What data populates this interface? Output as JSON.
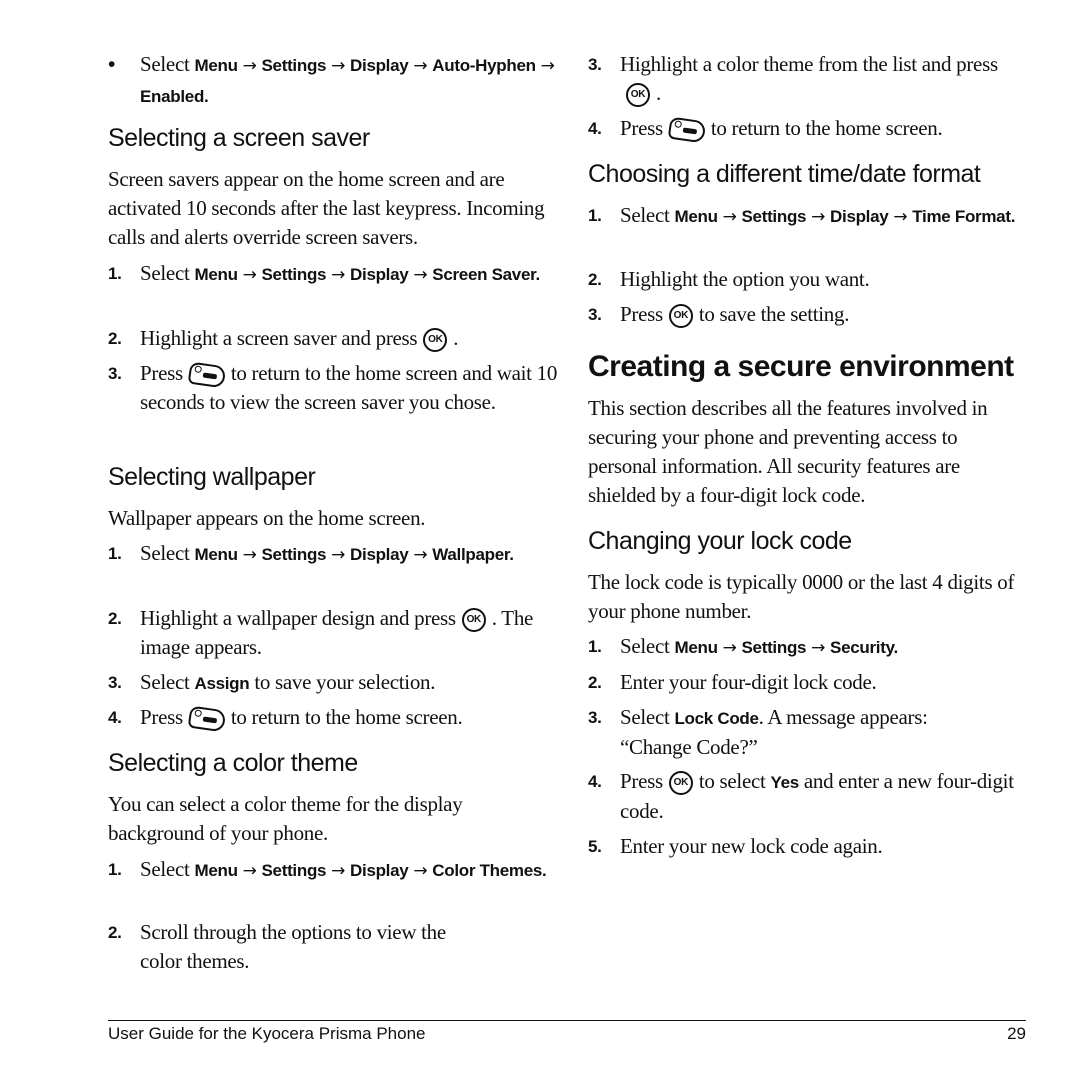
{
  "left": {
    "intro_bullet": {
      "select": "Select",
      "menu": "Menu",
      "settings": "Settings",
      "display": "Display",
      "autohyphen": "Auto-Hyphen",
      "enabled": "Enabled",
      "arrow": "→",
      "bullet": "•"
    },
    "screen_saver": {
      "heading": "Selecting a screen saver",
      "para": "Screen savers appear on the home screen and are activated 10 seconds after the last keypress. Incoming calls and alerts override screen savers.",
      "steps": [
        {
          "num": "1.",
          "select": "Select",
          "menu": "Menu",
          "settings": "Settings",
          "display": "Display",
          "target": "Screen Saver."
        },
        {
          "num": "2.",
          "pre": "Highlight a screen saver and press",
          "post": "."
        },
        {
          "num": "3.",
          "pre": "Press",
          "post": "to return to the home screen and wait 10 seconds to view the screen saver you chose."
        }
      ]
    },
    "wallpaper": {
      "heading": "Selecting wallpaper",
      "para": "Wallpaper appears on the home screen.",
      "steps": [
        {
          "num": "1.",
          "select": "Select",
          "menu": "Menu",
          "settings": "Settings",
          "display": "Display",
          "target": "Wallpaper"
        },
        {
          "num": "2.",
          "pre": "Highlight a wallpaper design and press",
          "post": ". The image appears."
        },
        {
          "num": "3.",
          "pre": "Select",
          "bold": "Assign",
          "post": "to save your selection."
        },
        {
          "num": "4.",
          "pre": "Press",
          "post": "to return to the home screen."
        }
      ]
    },
    "color_theme": {
      "heading": "Selecting a color theme",
      "para": "You can select a color theme for the display background of your phone.",
      "steps": [
        {
          "num": "1.",
          "select": "Select",
          "menu": "Menu",
          "settings": "Settings",
          "display": "Display",
          "target": "Color Themes"
        },
        {
          "num": "2.",
          "text": "Scroll through the options to view the color themes."
        }
      ]
    }
  },
  "right": {
    "color_theme_cont": [
      {
        "num": "3.",
        "pre": "Highlight a color theme from the list and press",
        "post": "."
      },
      {
        "num": "4.",
        "pre": "Press",
        "post": "to return to the home screen."
      }
    ],
    "time_date": {
      "heading": "Choosing a different time/date format",
      "steps": [
        {
          "num": "1.",
          "select": "Select",
          "menu": "Menu",
          "settings": "Settings",
          "display": "Display",
          "target": "Time Format"
        },
        {
          "num": "2.",
          "text": "Highlight the option you want."
        },
        {
          "num": "3.",
          "pre": "Press",
          "post": "to save the setting."
        }
      ]
    },
    "secure": {
      "heading": "Creating a secure environment",
      "para": "This section describes all the features involved in securing your phone and preventing access to personal information. All security features are shielded by a four-digit lock code."
    },
    "lock_code": {
      "heading": "Changing your lock code",
      "para": "The lock code is typically 0000 or the last 4 digits of your phone number.",
      "steps": [
        {
          "num": "1.",
          "select": "Select",
          "menu": "Menu",
          "settings": "Settings",
          "target": "Security"
        },
        {
          "num": "2.",
          "text": "Enter your four-digit lock code."
        },
        {
          "num": "3.",
          "pre": "Select",
          "bold": "Lock Code",
          "post": ". A message appears: “Change Code?”"
        },
        {
          "num": "4.",
          "pre": "Press",
          "mid": "to select",
          "bold": "Yes",
          "post": "and enter a new four-digit code."
        },
        {
          "num": "5.",
          "text": "Enter your new lock code again."
        }
      ]
    }
  },
  "icons": {
    "ok": "OK"
  },
  "footer": {
    "title": "User Guide for the Kyocera Prisma Phone",
    "page": "29"
  }
}
